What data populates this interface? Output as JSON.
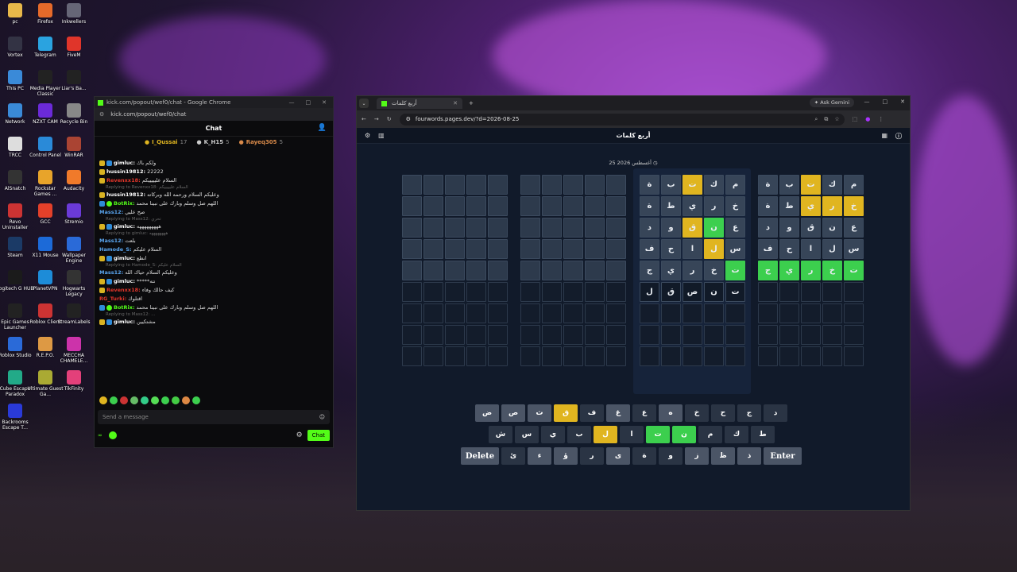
{
  "desktop_icons": [
    {
      "label": "pc",
      "color": "#e8b84a"
    },
    {
      "label": "Firefox",
      "color": "#e66a2a"
    },
    {
      "label": "Inkwellers",
      "color": "#667"
    },
    {
      "label": "Vortex",
      "color": "#334"
    },
    {
      "label": "Telegram",
      "color": "#2aa3e0"
    },
    {
      "label": "FiveM",
      "color": "#e0352a"
    },
    {
      "label": "This PC",
      "color": "#3a8ad8"
    },
    {
      "label": "Media Player Classic",
      "color": "#222"
    },
    {
      "label": "Liar's Ba...",
      "color": "#222"
    },
    {
      "label": "Network",
      "color": "#3a8ad8"
    },
    {
      "label": "NZXT CAM",
      "color": "#6b2ad8"
    },
    {
      "label": "Recycle Bin",
      "color": "#888"
    },
    {
      "label": "TRCC",
      "color": "#ddd"
    },
    {
      "label": "Control Panel",
      "color": "#2a8ad8"
    },
    {
      "label": "WinRAR",
      "color": "#a43"
    },
    {
      "label": "AlSnatch",
      "color": "#333"
    },
    {
      "label": "Rockstar Games ...",
      "color": "#e8a42a"
    },
    {
      "label": "Audacity",
      "color": "#f07a2a"
    },
    {
      "label": "Revo Uninstaller",
      "color": "#c33"
    },
    {
      "label": "GCC",
      "color": "#e3402a"
    },
    {
      "label": "Stremio",
      "color": "#6b3ad8"
    },
    {
      "label": "Steam",
      "color": "#1b3a66"
    },
    {
      "label": "X11 Mouse",
      "color": "#1c6ad8"
    },
    {
      "label": "Wallpaper Engine",
      "color": "#2a6ad8"
    },
    {
      "label": "Logitech G HUB",
      "color": "#1b1b1b"
    },
    {
      "label": "PlanetVPN",
      "color": "#1d8cd8"
    },
    {
      "label": "Hogwarts Legacy",
      "color": "#333"
    },
    {
      "label": "Epic Games Launcher",
      "color": "#222"
    },
    {
      "label": "Roblox Client",
      "color": "#c33"
    },
    {
      "label": "StreamLabels",
      "color": "#222"
    },
    {
      "label": "Roblox Studio",
      "color": "#2a6ad8"
    },
    {
      "label": "R.E.P.O.",
      "color": "#d94"
    },
    {
      "label": "MECCHA CHAMELE...",
      "color": "#c3a"
    },
    {
      "label": "Cube Escape Paradox",
      "color": "#2a8"
    },
    {
      "label": "Ultimate Guest Ga...",
      "color": "#aa3"
    },
    {
      "label": "TikFinity",
      "color": "#e3407a"
    },
    {
      "label": "Backrooms Escape T...",
      "color": "#2a3ad8"
    }
  ],
  "chat_window": {
    "title": "kick.com/popout/wef0/chat - Google Chrome",
    "url": "kick.com/popout/wef0/chat",
    "header": "Chat",
    "leaders": [
      {
        "name": "I_Qussai",
        "count": "17",
        "color": "#e0b520"
      },
      {
        "name": "K_H15",
        "count": "5",
        "color": "#cccccc"
      },
      {
        "name": "Rayeq305",
        "count": "5",
        "color": "#d98a4a"
      }
    ],
    "messages": [
      {
        "type": "msg",
        "badges": [
          "y",
          "b"
        ],
        "user": "gimluc",
        "user_color": "#ffffff",
        "text": "ولكم باك"
      },
      {
        "type": "msg",
        "badges": [
          "y"
        ],
        "user": "hussin19812",
        "user_color": "#ffffff",
        "text": "22222"
      },
      {
        "type": "msg",
        "badges": [
          "y"
        ],
        "user": "Revenxx18",
        "user_color": "#e0352a",
        "text": "السلام عليييييكم"
      },
      {
        "type": "reply",
        "text": "Replying to Revenxx18: السلام عليييييكم"
      },
      {
        "type": "msg",
        "badges": [
          "y"
        ],
        "user": "hussin19812",
        "user_color": "#ffffff",
        "text": "وعليكم السلام ورحمه الله وبركاته"
      },
      {
        "type": "msg",
        "badges": [
          "b",
          "g"
        ],
        "user": "BotRix",
        "user_color": "#53fc18",
        "text": "اللهم صل وسلم وبارك على نبينا محمد"
      },
      {
        "type": "msg",
        "badges": [],
        "user": "Mass12",
        "user_color": "#5aa6f0",
        "text": "صح عليي"
      },
      {
        "type": "reply",
        "text": "Replying to Mass12: تحري"
      },
      {
        "type": "msg",
        "badges": [
          "y",
          "b"
        ],
        "user": "gimluc",
        "user_color": "#ffffff",
        "text": "هههههههههه"
      },
      {
        "type": "reply",
        "text": "Replying to gimluc: ههههههههه"
      },
      {
        "type": "msg",
        "badges": [],
        "user": "Mass12",
        "user_color": "#5aa6f0",
        "text": "بلعت"
      },
      {
        "type": "msg",
        "badges": [],
        "user": "Hamode_S",
        "user_color": "#5aa6f0",
        "text": "السلام عليكم"
      },
      {
        "type": "msg",
        "badges": [
          "y",
          "b"
        ],
        "user": "gimluc",
        "user_color": "#ffffff",
        "text": "انطع"
      },
      {
        "type": "reply",
        "text": "Replying to Hamode_S: السلام عليكم"
      },
      {
        "type": "msg",
        "badges": [],
        "user": "Mass12",
        "user_color": "#5aa6f0",
        "text": "وعليكم السلام حياك الله"
      },
      {
        "type": "msg",
        "badges": [
          "y",
          "b"
        ],
        "user": "gimluc",
        "user_color": "#ffffff",
        "text": "*****نته"
      },
      {
        "type": "msg",
        "badges": [
          "y"
        ],
        "user": "Revenxx18",
        "user_color": "#e0352a",
        "text": "كيف حالك وفاء"
      },
      {
        "type": "msg",
        "badges": [],
        "user": "RG_Turki",
        "user_color": "#e0352a",
        "text": "اقتلوك"
      },
      {
        "type": "msg",
        "badges": [
          "b",
          "g"
        ],
        "user": "BotRix",
        "user_color": "#53fc18",
        "text": "اللهم صل وسلم وبارك على نبينا محمد"
      },
      {
        "type": "reply",
        "text": "Replying to Mass12: ..."
      },
      {
        "type": "msg",
        "badges": [
          "y",
          "b"
        ],
        "user": "gimluc",
        "user_color": "#ffffff",
        "text": "مشتكيين"
      }
    ],
    "send_placeholder": "Send a message",
    "points": "∞",
    "chat_button": "Chat"
  },
  "browser": {
    "tab_title": "أربع كلمات",
    "ask_gemini": "Ask Gemini",
    "url": "fourwords.pages.dev/?d=2026-08-25",
    "app_title": "أربع كلمات",
    "date": "25 أغسطس 2026"
  },
  "boards": [
    {
      "rows": [
        [
          [
            "",
            ""
          ],
          [
            "",
            ""
          ],
          [
            "",
            ""
          ],
          [
            "",
            ""
          ],
          [
            "",
            ""
          ]
        ],
        [
          [
            "",
            ""
          ],
          [
            "",
            ""
          ],
          [
            "",
            ""
          ],
          [
            "",
            ""
          ],
          [
            "",
            ""
          ]
        ],
        [
          [
            "",
            ""
          ],
          [
            "",
            ""
          ],
          [
            "",
            ""
          ],
          [
            "",
            ""
          ],
          [
            "",
            ""
          ]
        ],
        [
          [
            "",
            ""
          ],
          [
            "",
            ""
          ],
          [
            "",
            ""
          ],
          [
            "",
            ""
          ],
          [
            "",
            ""
          ]
        ],
        [
          [
            "",
            ""
          ],
          [
            "",
            ""
          ],
          [
            "",
            ""
          ],
          [
            "",
            ""
          ],
          [
            "",
            ""
          ]
        ],
        [
          [
            "",
            "empty"
          ],
          [
            "",
            "empty"
          ],
          [
            "",
            "empty"
          ],
          [
            "",
            "empty"
          ],
          [
            "",
            "empty"
          ]
        ],
        [
          [
            "",
            "empty"
          ],
          [
            "",
            "empty"
          ],
          [
            "",
            "empty"
          ],
          [
            "",
            "empty"
          ],
          [
            "",
            "empty"
          ]
        ],
        [
          [
            "",
            "empty"
          ],
          [
            "",
            "empty"
          ],
          [
            "",
            "empty"
          ],
          [
            "",
            "empty"
          ],
          [
            "",
            "empty"
          ]
        ],
        [
          [
            "",
            "empty"
          ],
          [
            "",
            "empty"
          ],
          [
            "",
            "empty"
          ],
          [
            "",
            "empty"
          ],
          [
            "",
            "empty"
          ]
        ]
      ]
    },
    {
      "rows": [
        [
          [
            "",
            ""
          ],
          [
            "",
            ""
          ],
          [
            "",
            ""
          ],
          [
            "",
            ""
          ],
          [
            "",
            ""
          ]
        ],
        [
          [
            "",
            ""
          ],
          [
            "",
            ""
          ],
          [
            "",
            ""
          ],
          [
            "",
            ""
          ],
          [
            "",
            ""
          ]
        ],
        [
          [
            "",
            ""
          ],
          [
            "",
            ""
          ],
          [
            "",
            ""
          ],
          [
            "",
            ""
          ],
          [
            "",
            ""
          ]
        ],
        [
          [
            "",
            ""
          ],
          [
            "",
            ""
          ],
          [
            "",
            ""
          ],
          [
            "",
            ""
          ],
          [
            "",
            ""
          ]
        ],
        [
          [
            "",
            ""
          ],
          [
            "",
            ""
          ],
          [
            "",
            ""
          ],
          [
            "",
            ""
          ],
          [
            "",
            ""
          ]
        ],
        [
          [
            "",
            "empty"
          ],
          [
            "",
            "empty"
          ],
          [
            "",
            "empty"
          ],
          [
            "",
            "empty"
          ],
          [
            "",
            "empty"
          ]
        ],
        [
          [
            "",
            "empty"
          ],
          [
            "",
            "empty"
          ],
          [
            "",
            "empty"
          ],
          [
            "",
            "empty"
          ],
          [
            "",
            "empty"
          ]
        ],
        [
          [
            "",
            "empty"
          ],
          [
            "",
            "empty"
          ],
          [
            "",
            "empty"
          ],
          [
            "",
            "empty"
          ],
          [
            "",
            "empty"
          ]
        ],
        [
          [
            "",
            "empty"
          ],
          [
            "",
            "empty"
          ],
          [
            "",
            "empty"
          ],
          [
            "",
            "empty"
          ],
          [
            "",
            "empty"
          ]
        ]
      ]
    },
    {
      "rows": [
        [
          [
            "ة",
            "gr"
          ],
          [
            "ب",
            "gr"
          ],
          [
            "ت",
            "Y"
          ],
          [
            "ك",
            "gr"
          ],
          [
            "م",
            "gr"
          ]
        ],
        [
          [
            "ة",
            "gr"
          ],
          [
            "ط",
            "gr"
          ],
          [
            "ي",
            "gr"
          ],
          [
            "ر",
            "gr"
          ],
          [
            "خ",
            "gr"
          ]
        ],
        [
          [
            "د",
            "gr"
          ],
          [
            "و",
            "gr"
          ],
          [
            "ق",
            "Y"
          ],
          [
            "ن",
            "G"
          ],
          [
            "ع",
            "gr"
          ]
        ],
        [
          [
            "ف",
            "gr"
          ],
          [
            "ح",
            "gr"
          ],
          [
            "ا",
            "gr"
          ],
          [
            "ل",
            "Y"
          ],
          [
            "س",
            "gr"
          ]
        ],
        [
          [
            "ج",
            "gr"
          ],
          [
            "ي",
            "gr"
          ],
          [
            "ر",
            "gr"
          ],
          [
            "خ",
            "gr"
          ],
          [
            "ت",
            "G"
          ]
        ],
        [
          [
            "ل",
            "typed"
          ],
          [
            "ق",
            "typed"
          ],
          [
            "ص",
            "typed"
          ],
          [
            "ن",
            "typed"
          ],
          [
            "ت",
            "typed"
          ]
        ],
        [
          [
            "",
            "empty"
          ],
          [
            "",
            "empty"
          ],
          [
            "",
            "empty"
          ],
          [
            "",
            "empty"
          ],
          [
            "",
            "empty"
          ]
        ],
        [
          [
            "",
            "empty"
          ],
          [
            "",
            "empty"
          ],
          [
            "",
            "empty"
          ],
          [
            "",
            "empty"
          ],
          [
            "",
            "empty"
          ]
        ],
        [
          [
            "",
            "empty"
          ],
          [
            "",
            "empty"
          ],
          [
            "",
            "empty"
          ],
          [
            "",
            "empty"
          ],
          [
            "",
            "empty"
          ]
        ]
      ]
    },
    {
      "rows": [
        [
          [
            "ة",
            "gr"
          ],
          [
            "ب",
            "gr"
          ],
          [
            "ت",
            "Y"
          ],
          [
            "ك",
            "gr"
          ],
          [
            "م",
            "gr"
          ]
        ],
        [
          [
            "ة",
            "gr"
          ],
          [
            "ط",
            "gr"
          ],
          [
            "ي",
            "Y"
          ],
          [
            "ر",
            "Y"
          ],
          [
            "خ",
            "Y"
          ]
        ],
        [
          [
            "د",
            "gr"
          ],
          [
            "و",
            "gr"
          ],
          [
            "ق",
            "gr"
          ],
          [
            "ن",
            "gr"
          ],
          [
            "ع",
            "gr"
          ]
        ],
        [
          [
            "ف",
            "gr"
          ],
          [
            "ح",
            "gr"
          ],
          [
            "ا",
            "gr"
          ],
          [
            "ل",
            "gr"
          ],
          [
            "س",
            "gr"
          ]
        ],
        [
          [
            "ج",
            "G"
          ],
          [
            "ي",
            "G"
          ],
          [
            "ر",
            "G"
          ],
          [
            "خ",
            "G"
          ],
          [
            "ت",
            "G"
          ]
        ],
        [
          [
            "",
            "empty"
          ],
          [
            "",
            "empty"
          ],
          [
            "",
            "empty"
          ],
          [
            "",
            "empty"
          ],
          [
            "",
            "empty"
          ]
        ],
        [
          [
            "",
            "empty"
          ],
          [
            "",
            "empty"
          ],
          [
            "",
            "empty"
          ],
          [
            "",
            "empty"
          ],
          [
            "",
            "empty"
          ]
        ],
        [
          [
            "",
            "empty"
          ],
          [
            "",
            "empty"
          ],
          [
            "",
            "empty"
          ],
          [
            "",
            "empty"
          ],
          [
            "",
            "empty"
          ]
        ],
        [
          [
            "",
            "empty"
          ],
          [
            "",
            "empty"
          ],
          [
            "",
            "empty"
          ],
          [
            "",
            "empty"
          ],
          [
            "",
            "empty"
          ]
        ]
      ]
    }
  ],
  "keyboard": {
    "row1": [
      [
        "ض",
        ""
      ],
      [
        "ص",
        ""
      ],
      [
        "ث",
        ""
      ],
      [
        "ق",
        "Y"
      ],
      [
        "ف",
        "dk"
      ],
      [
        "غ",
        ""
      ],
      [
        "ع",
        "dk"
      ],
      [
        "ه",
        ""
      ],
      [
        "خ",
        "dk"
      ],
      [
        "ح",
        "dk"
      ],
      [
        "ج",
        "dk"
      ],
      [
        "د",
        "dk"
      ]
    ],
    "row2": [
      [
        "ش",
        "dk"
      ],
      [
        "س",
        "dk"
      ],
      [
        "ي",
        "dk"
      ],
      [
        "ب",
        "dk"
      ],
      [
        "ل",
        "Y"
      ],
      [
        "ا",
        "dk"
      ],
      [
        "ت",
        "G"
      ],
      [
        "ن",
        "G"
      ],
      [
        "م",
        "dk"
      ],
      [
        "ك",
        "dk"
      ],
      [
        "ط",
        "dk"
      ]
    ],
    "row3": [
      [
        "Delete",
        "wide"
      ],
      [
        "ئ",
        "dk"
      ],
      [
        "ء",
        ""
      ],
      [
        "ؤ",
        ""
      ],
      [
        "ر",
        "dk"
      ],
      [
        "ى",
        ""
      ],
      [
        "ة",
        "dk"
      ],
      [
        "و",
        "dk"
      ],
      [
        "ز",
        ""
      ],
      [
        "ظ",
        ""
      ],
      [
        "ذ",
        ""
      ],
      [
        "Enter",
        "wide"
      ]
    ]
  }
}
